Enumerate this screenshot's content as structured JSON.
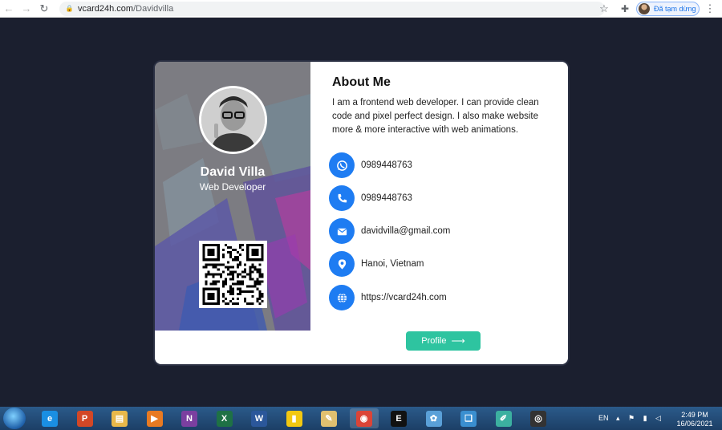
{
  "browser": {
    "url_host": "vcard24h.com",
    "url_path": "/Davidvilla",
    "profile_label": "Đã tạm dừng"
  },
  "card": {
    "name": "David Villa",
    "role": "Web Developer",
    "about_title": "About Me",
    "about_text": "I am a frontend web developer. I can provide clean code and pixel perfect design. I also make website more & more interactive with web animations.",
    "contacts": [
      {
        "icon": "whatsapp-icon",
        "value": "0989448763"
      },
      {
        "icon": "phone-icon",
        "value": "0989448763"
      },
      {
        "icon": "envelope-icon",
        "value": "davidvilla@gmail.com"
      },
      {
        "icon": "map-marker-icon",
        "value": "Hanoi, Vietnam"
      },
      {
        "icon": "globe-icon",
        "value": "https://vcard24h.com"
      }
    ],
    "profile_button": "Profile",
    "accent_color": "#1e7cf2",
    "button_color": "#2ec4a0"
  },
  "taskbar": {
    "apps": [
      {
        "icon": "internet-explorer-icon",
        "glyph": "e",
        "color": "#1a8fe3"
      },
      {
        "icon": "powerpoint-icon",
        "glyph": "P",
        "color": "#d24726"
      },
      {
        "icon": "file-explorer-icon",
        "glyph": "▤",
        "color": "#e8b84a"
      },
      {
        "icon": "media-player-icon",
        "glyph": "▶",
        "color": "#e87a22"
      },
      {
        "icon": "onenote-icon",
        "glyph": "N",
        "color": "#7b3fa0"
      },
      {
        "icon": "excel-icon",
        "glyph": "X",
        "color": "#1e7145"
      },
      {
        "icon": "word-icon",
        "glyph": "W",
        "color": "#2b579a"
      },
      {
        "icon": "power-bi-icon",
        "glyph": "▮",
        "color": "#f2c811"
      },
      {
        "icon": "notepad-icon",
        "glyph": "✎",
        "color": "#e0c070"
      },
      {
        "icon": "chrome-icon",
        "glyph": "◉",
        "color": "#db4437"
      },
      {
        "icon": "terminal-icon",
        "glyph": "E",
        "color": "#111111"
      },
      {
        "icon": "paint-icon",
        "glyph": "✿",
        "color": "#5aa0d8"
      },
      {
        "icon": "book-icon",
        "glyph": "❑",
        "color": "#3a8fd0"
      },
      {
        "icon": "editor-icon",
        "glyph": "✐",
        "color": "#3cb0a0"
      },
      {
        "icon": "eye-app-icon",
        "glyph": "◎",
        "color": "#333333"
      }
    ],
    "lang": "EN",
    "time": "2:49 PM",
    "date": "16/06/2021"
  }
}
